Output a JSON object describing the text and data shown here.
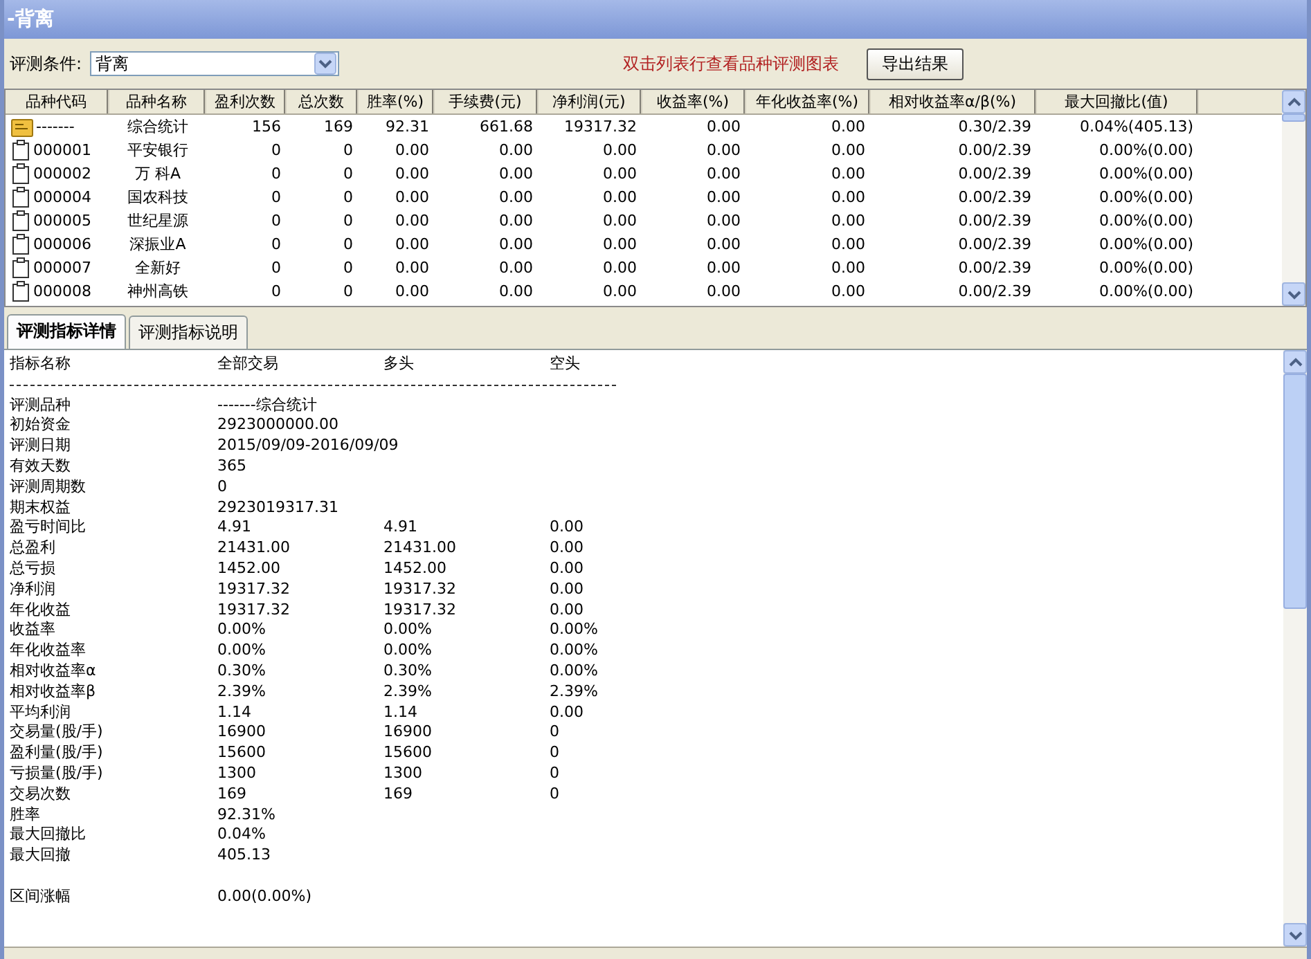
{
  "window": {
    "title": "-背离"
  },
  "toolbar": {
    "condition_label": "评测条件:",
    "condition_value": "背离",
    "hint": "双击列表行查看品种评测图表",
    "export_button": "导出结果"
  },
  "table": {
    "columns": [
      "品种代码",
      "品种名称",
      "盈利次数",
      "总次数",
      "胜率(%)",
      "手续费(元)",
      "净利润(元)",
      "收益率(%)",
      "年化收益率(%)",
      "相对收益率α/β(%)",
      "最大回撤比(值)"
    ],
    "rows": [
      {
        "kind": "summary",
        "cells": [
          "-------",
          "综合统计",
          "156",
          "169",
          "92.31",
          "661.68",
          "19317.32",
          "0.00",
          "0.00",
          "0.30/2.39",
          "0.04%(405.13)"
        ]
      },
      {
        "kind": "stock",
        "cells": [
          "000001",
          "平安银行",
          "0",
          "0",
          "0.00",
          "0.00",
          "0.00",
          "0.00",
          "0.00",
          "0.00/2.39",
          "0.00%(0.00)"
        ]
      },
      {
        "kind": "stock",
        "cells": [
          "000002",
          "万 科A",
          "0",
          "0",
          "0.00",
          "0.00",
          "0.00",
          "0.00",
          "0.00",
          "0.00/2.39",
          "0.00%(0.00)"
        ]
      },
      {
        "kind": "stock",
        "cells": [
          "000004",
          "国农科技",
          "0",
          "0",
          "0.00",
          "0.00",
          "0.00",
          "0.00",
          "0.00",
          "0.00/2.39",
          "0.00%(0.00)"
        ]
      },
      {
        "kind": "stock",
        "cells": [
          "000005",
          "世纪星源",
          "0",
          "0",
          "0.00",
          "0.00",
          "0.00",
          "0.00",
          "0.00",
          "0.00/2.39",
          "0.00%(0.00)"
        ]
      },
      {
        "kind": "stock",
        "cells": [
          "000006",
          "深振业A",
          "0",
          "0",
          "0.00",
          "0.00",
          "0.00",
          "0.00",
          "0.00",
          "0.00/2.39",
          "0.00%(0.00)"
        ]
      },
      {
        "kind": "stock",
        "cells": [
          "000007",
          "全新好",
          "0",
          "0",
          "0.00",
          "0.00",
          "0.00",
          "0.00",
          "0.00",
          "0.00/2.39",
          "0.00%(0.00)"
        ]
      },
      {
        "kind": "stock",
        "cells": [
          "000008",
          "神州高铁",
          "0",
          "0",
          "0.00",
          "0.00",
          "0.00",
          "0.00",
          "0.00",
          "0.00/2.39",
          "0.00%(0.00)"
        ]
      }
    ]
  },
  "tabs": [
    {
      "label": "评测指标详情",
      "selected": true
    },
    {
      "label": "评测指标说明",
      "selected": false
    }
  ],
  "details": [
    {
      "kind": "row",
      "cells": [
        "指标名称",
        "全部交易",
        "多头",
        "空头"
      ]
    },
    {
      "kind": "rule"
    },
    {
      "kind": "row",
      "cells": [
        "评测品种",
        "-------综合统计"
      ]
    },
    {
      "kind": "row",
      "cells": [
        "初始资金",
        "2923000000.00"
      ]
    },
    {
      "kind": "row",
      "cells": [
        "评测日期",
        "2015/09/09-2016/09/09"
      ]
    },
    {
      "kind": "row",
      "cells": [
        "有效天数",
        "365"
      ]
    },
    {
      "kind": "row",
      "cells": [
        "评测周期数",
        "0"
      ]
    },
    {
      "kind": "row",
      "cells": [
        "期末权益",
        "2923019317.31"
      ]
    },
    {
      "kind": "row",
      "cells": [
        "盈亏时间比",
        "4.91",
        "4.91",
        "0.00"
      ]
    },
    {
      "kind": "row",
      "cells": [
        "总盈利",
        "21431.00",
        "21431.00",
        "0.00"
      ]
    },
    {
      "kind": "row",
      "cells": [
        "总亏损",
        "1452.00",
        "1452.00",
        "0.00"
      ]
    },
    {
      "kind": "row",
      "cells": [
        "净利润",
        "19317.32",
        "19317.32",
        "0.00"
      ]
    },
    {
      "kind": "row",
      "cells": [
        "年化收益",
        "19317.32",
        "19317.32",
        "0.00"
      ]
    },
    {
      "kind": "row",
      "cells": [
        "收益率",
        "0.00%",
        "0.00%",
        "0.00%"
      ]
    },
    {
      "kind": "row",
      "cells": [
        "年化收益率",
        "0.00%",
        "0.00%",
        "0.00%"
      ]
    },
    {
      "kind": "row",
      "cells": [
        "相对收益率α",
        "0.30%",
        "0.30%",
        "0.00%"
      ]
    },
    {
      "kind": "row",
      "cells": [
        "相对收益率β",
        "2.39%",
        "2.39%",
        "2.39%"
      ]
    },
    {
      "kind": "row",
      "cells": [
        "平均利润",
        "1.14",
        "1.14",
        "0.00"
      ]
    },
    {
      "kind": "row",
      "cells": [
        "交易量(股/手)",
        "16900",
        "16900",
        "0"
      ]
    },
    {
      "kind": "row",
      "cells": [
        "盈利量(股/手)",
        "15600",
        "15600",
        "0"
      ]
    },
    {
      "kind": "row",
      "cells": [
        "亏损量(股/手)",
        "1300",
        "1300",
        "0"
      ]
    },
    {
      "kind": "row",
      "cells": [
        "交易次数",
        "169",
        "169",
        "0"
      ]
    },
    {
      "kind": "row",
      "cells": [
        "胜率",
        "92.31%"
      ]
    },
    {
      "kind": "row",
      "cells": [
        "最大回撤比",
        "0.04%"
      ]
    },
    {
      "kind": "row",
      "cells": [
        "最大回撤",
        "405.13"
      ]
    },
    {
      "kind": "gap"
    },
    {
      "kind": "row",
      "cells": [
        "区间涨幅",
        "0.00(0.00%)"
      ]
    }
  ]
}
